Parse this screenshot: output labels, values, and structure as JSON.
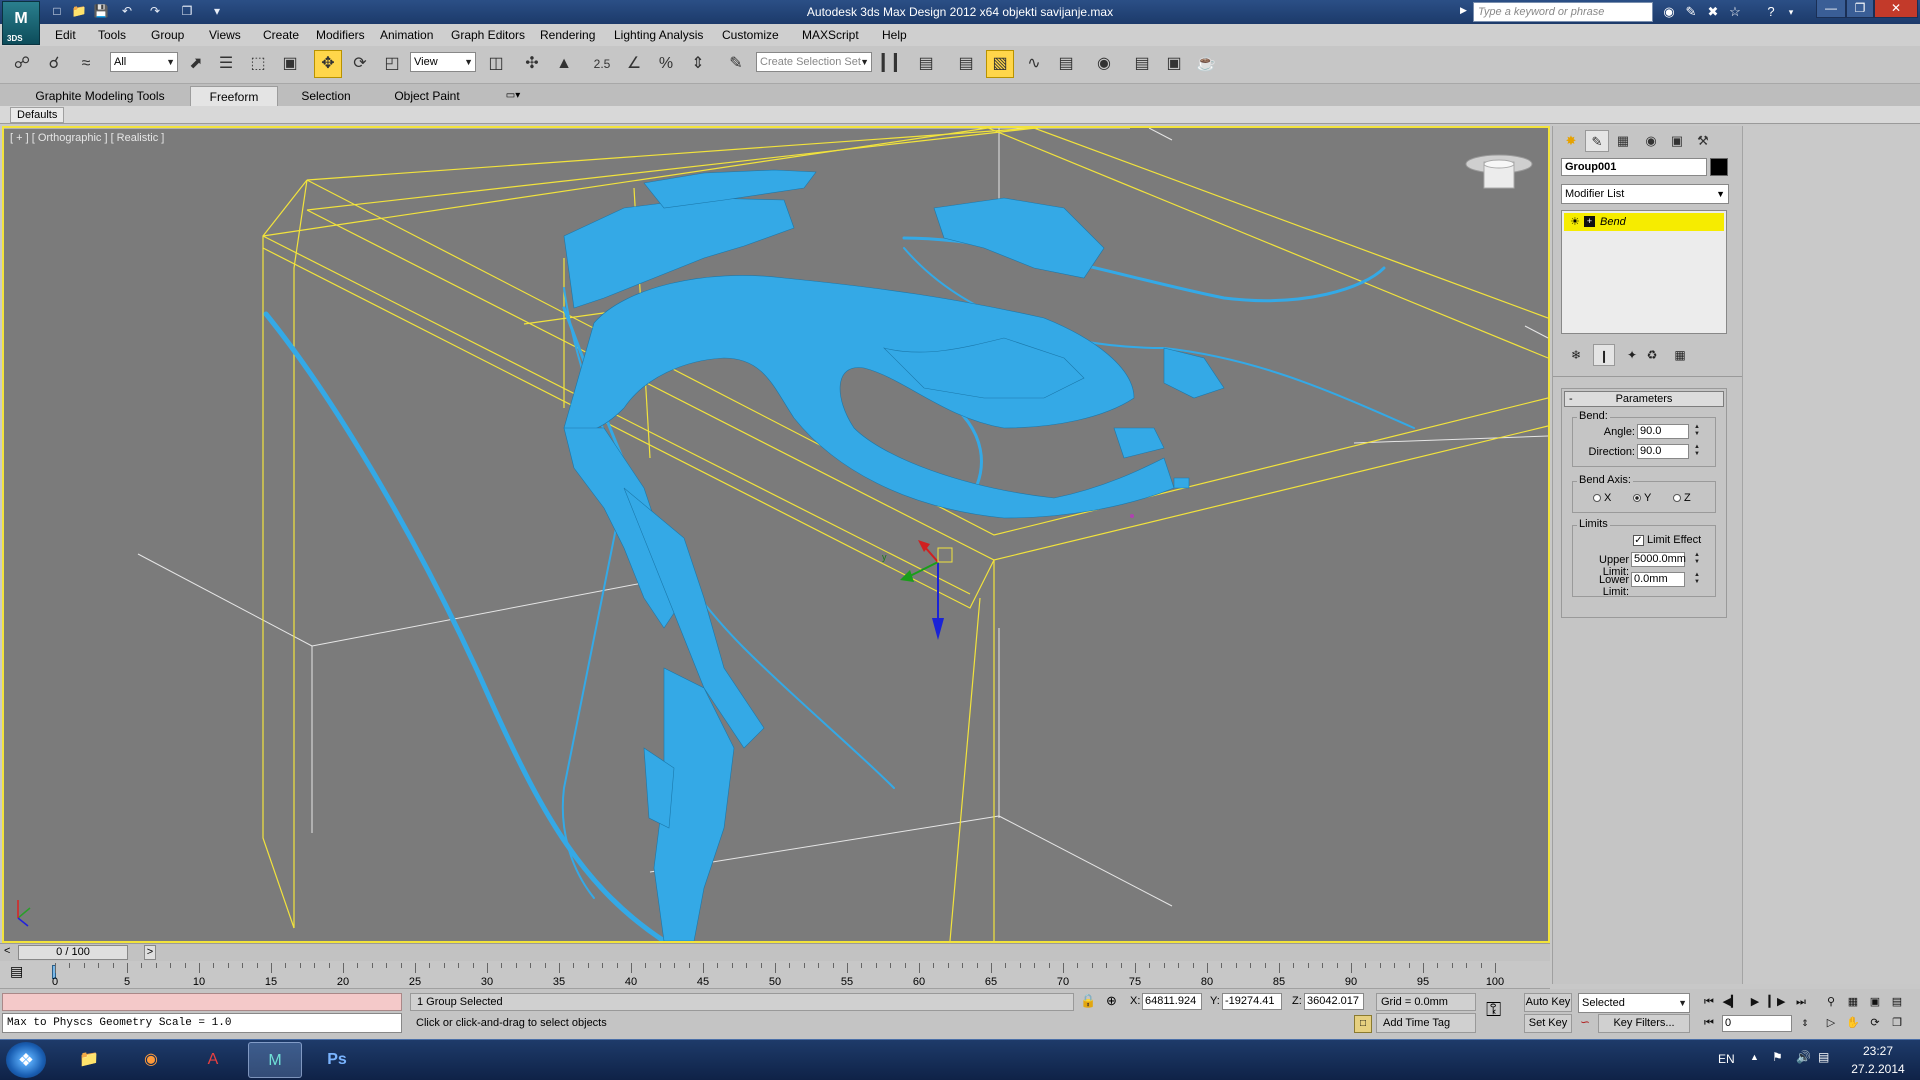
{
  "window": {
    "title": "Autodesk 3ds Max Design 2012 x64      objekti savijanje.max",
    "logo_text": "M",
    "logo_sub": "3DS",
    "search_placeholder": "Type a keyword or phrase"
  },
  "menu": [
    "Edit",
    "Tools",
    "Group",
    "Views",
    "Create",
    "Modifiers",
    "Animation",
    "Graph Editors",
    "Rendering",
    "Lighting Analysis",
    "Customize",
    "MAXScript",
    "Help"
  ],
  "toolbar": {
    "selection_filter": "All",
    "ref_coord": "View",
    "selection_set_placeholder": "Create Selection Set",
    "snap_angle_label": "2.5"
  },
  "ribbon": {
    "tabs": [
      "Graphite Modeling Tools",
      "Freeform",
      "Selection",
      "Object Paint"
    ],
    "active_tab": "Freeform",
    "panel_label": "Defaults"
  },
  "viewport": {
    "label": "[ + ] [ Orthographic ] [ Realistic ]",
    "border_color": "#f2e33c",
    "background": "#7b7b7b",
    "mesh_color": "#34a9e6",
    "gizmo_axis_label": "y"
  },
  "command_panel": {
    "object_name": "Group001",
    "modifier_list": "Modifier List",
    "stack_item": "Bend",
    "rollout_title": "Parameters",
    "bend_group": "Bend:",
    "angle_label": "Angle:",
    "angle_value": "90.0",
    "direction_label": "Direction:",
    "direction_value": "90.0",
    "axis_group": "Bend Axis:",
    "axes": [
      "X",
      "Y",
      "Z"
    ],
    "selected_axis": "Y",
    "limits_group": "Limits",
    "limit_effect_label": "Limit Effect",
    "limit_effect_checked": true,
    "upper_limit_label": "Upper Limit:",
    "upper_limit_value": "5000.0mm",
    "lower_limit_label": "Lower Limit:",
    "lower_limit_value": "0.0mm"
  },
  "timeline": {
    "frame_display": "0 / 100",
    "ticks": [
      "0",
      "5",
      "10",
      "15",
      "20",
      "25",
      "30",
      "35",
      "40",
      "45",
      "50",
      "55",
      "60",
      "65",
      "70",
      "75",
      "80",
      "85",
      "90",
      "95",
      "100"
    ]
  },
  "status": {
    "maxscript_output": "Max to Physcs Geometry Scale = 1.0",
    "selection_info": "1 Group Selected",
    "prompt": "Click or click-and-drag to select objects",
    "x_label": "X:",
    "x_value": "64811.924",
    "y_label": "Y:",
    "y_value": "-19274.41",
    "z_label": "Z:",
    "z_value": "36042.017",
    "grid": "Grid = 0.0mm",
    "add_time_tag": "Add Time Tag",
    "auto_key": "Auto Key",
    "set_key": "Set Key",
    "key_mode": "Selected",
    "key_filters": "Key Filters...",
    "current_frame": "0"
  },
  "taskbar": {
    "language": "EN",
    "time": "23:27",
    "date": "27.2.2014",
    "apps": [
      "explorer-icon",
      "firefox-icon",
      "autocad-icon",
      "3dsmax-icon",
      "photoshop-icon"
    ],
    "ps_label": "Ps"
  }
}
